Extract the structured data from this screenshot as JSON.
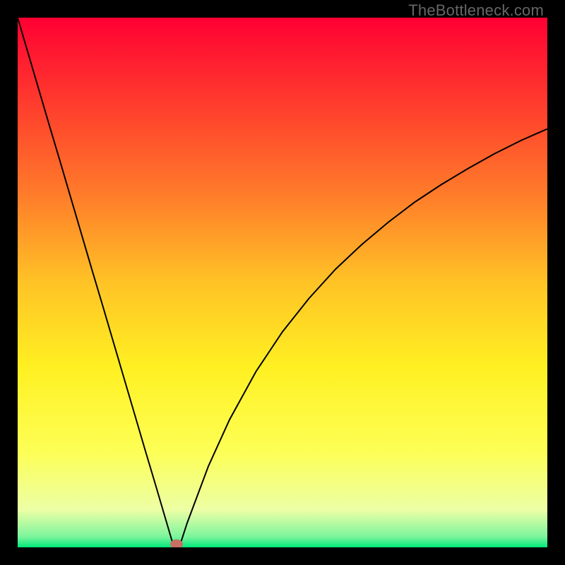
{
  "watermark": "TheBottleneck.com",
  "chart_data": {
    "type": "line",
    "title": "",
    "xlabel": "",
    "ylabel": "",
    "xlim": [
      0,
      100
    ],
    "ylim": [
      0,
      100
    ],
    "background": {
      "type": "vertical-gradient",
      "stops": [
        {
          "pos": 0.0,
          "color": "#ff0033"
        },
        {
          "pos": 0.16,
          "color": "#ff3b2d"
        },
        {
          "pos": 0.33,
          "color": "#ff7a2a"
        },
        {
          "pos": 0.5,
          "color": "#ffc326"
        },
        {
          "pos": 0.66,
          "color": "#fff022"
        },
        {
          "pos": 0.82,
          "color": "#fdff56"
        },
        {
          "pos": 0.93,
          "color": "#ecffa6"
        },
        {
          "pos": 0.98,
          "color": "#7cf59c"
        },
        {
          "pos": 1.0,
          "color": "#00e97a"
        }
      ]
    },
    "series": [
      {
        "name": "bottleneck-curve",
        "stroke": "#000000",
        "stroke_width": 2,
        "x": [
          0,
          2,
          4,
          6,
          8,
          10,
          12,
          14,
          16,
          18,
          20,
          22,
          24,
          26,
          28,
          29.5,
          30.5,
          32,
          36,
          40,
          45,
          50,
          55,
          60,
          65,
          70,
          75,
          80,
          85,
          90,
          95,
          100
        ],
        "y": [
          100,
          93.2,
          86.4,
          79.6,
          72.9,
          66.1,
          59.3,
          52.5,
          45.8,
          39.0,
          32.2,
          25.4,
          18.6,
          11.9,
          5.1,
          0.0,
          0.0,
          4.6,
          15.3,
          24.1,
          33.2,
          40.7,
          47.0,
          52.5,
          57.2,
          61.4,
          65.2,
          68.5,
          71.5,
          74.3,
          76.8,
          79.0
        ]
      }
    ],
    "marker": {
      "x": 30,
      "y": 0.6,
      "rx": 1.2,
      "ry": 0.9,
      "color": "#c77063"
    }
  }
}
